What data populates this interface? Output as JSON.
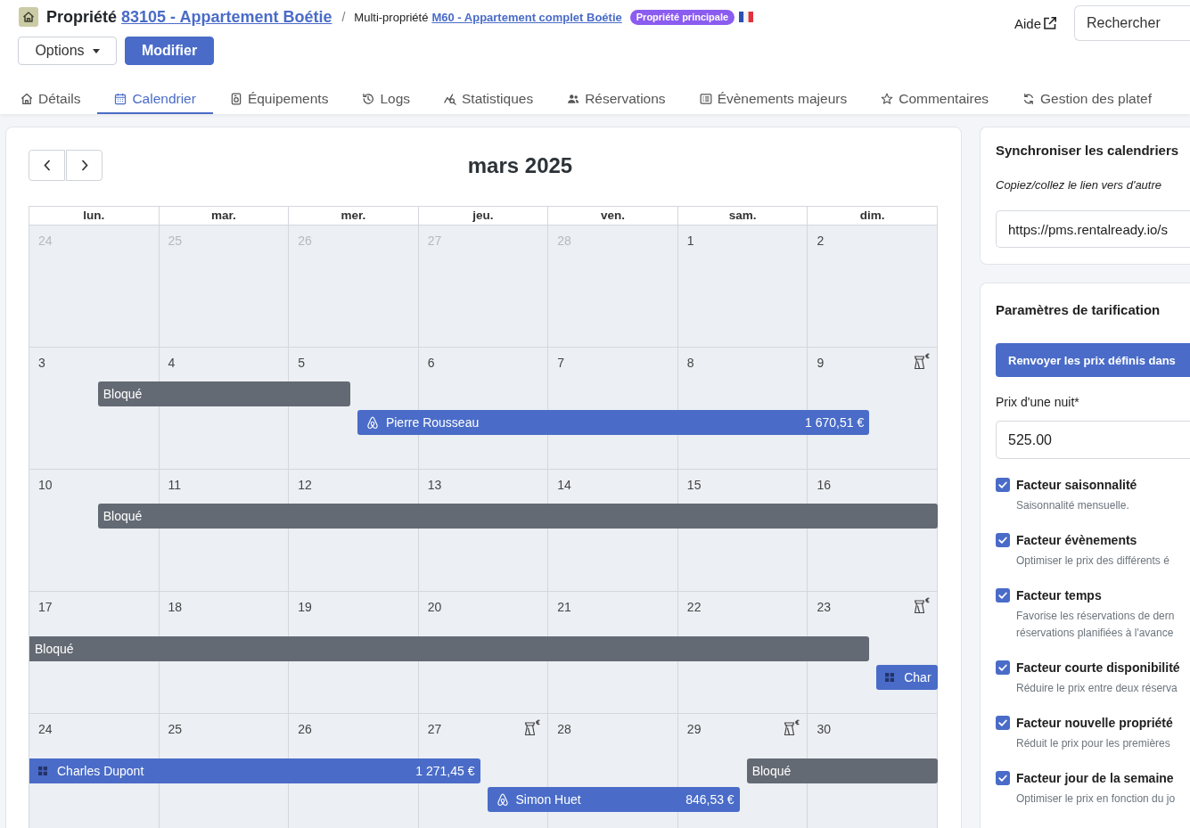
{
  "header": {
    "title": "Propriété",
    "property_link": "83105 - Appartement Boétie",
    "separator": "/",
    "parent_label": "Multi-propriété",
    "parent_link": "M60 - Appartement complet Boétie",
    "badge": "Propriété principale",
    "help": "Aide",
    "search": {
      "placeholder": "Rechercher"
    }
  },
  "actions": [
    {
      "kind": "dropdown",
      "label": "Options"
    },
    {
      "kind": "primary",
      "label": "Modifier"
    }
  ],
  "tabs": [
    {
      "label": "Détails",
      "selected": false
    },
    {
      "label": "Calendrier",
      "selected": true
    },
    {
      "label": "Équipements",
      "selected": false
    },
    {
      "label": "Logs",
      "selected": false
    },
    {
      "label": "Statistiques",
      "selected": false
    },
    {
      "label": "Réservations",
      "selected": false
    },
    {
      "label": "Évènements majeurs",
      "selected": false
    },
    {
      "label": "Commentaires",
      "selected": false
    },
    {
      "label": "Gestion des platef",
      "selected": false
    }
  ],
  "calendar": {
    "title": "mars 2025",
    "weekdays": [
      "lun.",
      "mar.",
      "mer.",
      "jeu.",
      "ven.",
      "sam.",
      "dim."
    ],
    "weeks": [
      {
        "days": [
          {
            "date": "24",
            "muted": true,
            "price_flag": false
          },
          {
            "date": "25",
            "muted": true,
            "price_flag": false
          },
          {
            "date": "26",
            "muted": true,
            "price_flag": false
          },
          {
            "date": "27",
            "muted": true,
            "price_flag": false
          },
          {
            "date": "28",
            "muted": true,
            "price_flag": false
          },
          {
            "date": "1",
            "muted": false,
            "price_flag": false
          },
          {
            "date": "2",
            "muted": false,
            "price_flag": false
          }
        ]
      },
      {
        "days": [
          {
            "date": "3",
            "muted": false,
            "price_flag": false,
            "bars": [
              {
                "kind": "blocked",
                "label": "Bloqué",
                "continued": false
              }
            ]
          },
          {
            "date": "4",
            "muted": false,
            "price_flag": false
          },
          {
            "date": "5",
            "muted": false,
            "price_flag": false,
            "ends": [
              {
                "kind": "blocked"
              }
            ],
            "bars": [
              {
                "kind": "airbnb",
                "label": "Pierre Rousseau",
                "amount": "1 670,51 €",
                "continued": false
              }
            ]
          },
          {
            "date": "6",
            "muted": false,
            "price_flag": false
          },
          {
            "date": "7",
            "muted": false,
            "price_flag": false
          },
          {
            "date": "8",
            "muted": false,
            "price_flag": false
          },
          {
            "date": "9",
            "muted": false,
            "price_flag": true,
            "ends": [
              {
                "kind": "airbnb"
              }
            ]
          }
        ]
      },
      {
        "days": [
          {
            "date": "10",
            "muted": false,
            "price_flag": false,
            "bars": [
              {
                "kind": "blocked",
                "label": "Bloqué",
                "continued": false
              }
            ]
          },
          {
            "date": "11",
            "muted": false,
            "price_flag": false
          },
          {
            "date": "12",
            "muted": false,
            "price_flag": false
          },
          {
            "date": "13",
            "muted": false,
            "price_flag": false
          },
          {
            "date": "14",
            "muted": false,
            "price_flag": false
          },
          {
            "date": "15",
            "muted": false,
            "price_flag": false
          },
          {
            "date": "16",
            "muted": false,
            "price_flag": false
          }
        ]
      },
      {
        "days": [
          {
            "date": "17",
            "muted": false,
            "price_flag": false,
            "bars": [
              {
                "kind": "blocked",
                "label": "Bloqué",
                "continued": true
              }
            ]
          },
          {
            "date": "18",
            "muted": false,
            "price_flag": false
          },
          {
            "date": "19",
            "muted": false,
            "price_flag": false
          },
          {
            "date": "20",
            "muted": false,
            "price_flag": false
          },
          {
            "date": "21",
            "muted": false,
            "price_flag": false
          },
          {
            "date": "22",
            "muted": false,
            "price_flag": false
          },
          {
            "date": "23",
            "muted": false,
            "price_flag": true,
            "ends": [
              {
                "kind": "blocked"
              }
            ],
            "bars": [
              {
                "kind": "booking",
                "label": "Char",
                "continued": false
              }
            ]
          }
        ]
      },
      {
        "days": [
          {
            "date": "24",
            "muted": false,
            "price_flag": false,
            "bars": [
              {
                "kind": "booking",
                "label": "Charles Dupont",
                "amount": "1 271,45 €",
                "continued": true
              }
            ]
          },
          {
            "date": "25",
            "muted": false,
            "price_flag": false
          },
          {
            "date": "26",
            "muted": false,
            "price_flag": false
          },
          {
            "date": "27",
            "muted": false,
            "price_flag": true,
            "ends": [
              {
                "kind": "booking"
              }
            ],
            "bars": [
              {
                "kind": "airbnb",
                "label": "Simon Huet",
                "amount": "846,53 €",
                "continued": false
              }
            ]
          },
          {
            "date": "28",
            "muted": false,
            "price_flag": false
          },
          {
            "date": "29",
            "muted": false,
            "price_flag": true,
            "ends": [
              {
                "kind": "airbnb"
              }
            ],
            "bars": [
              {
                "kind": "blocked",
                "label": "Bloqué",
                "continued": false
              }
            ]
          },
          {
            "date": "30",
            "muted": false,
            "price_flag": false
          }
        ]
      }
    ]
  },
  "sync": {
    "title": "Synchroniser les calendriers",
    "hint": "Copiez/collez le lien vers d'autre",
    "url": "https://pms.rentalready.io/s"
  },
  "pricing": {
    "title": "Paramètres de tarification",
    "reset_button": "Renvoyer les prix définis dans",
    "price_label": "Prix d'une nuit*",
    "price_value": "525.00",
    "factors": [
      {
        "label": "Facteur saisonnalité",
        "description": [
          "Saisonnalité mensuelle."
        ],
        "checked": true
      },
      {
        "label": "Facteur évènements",
        "description": [
          "Optimiser le prix des différents é"
        ],
        "checked": true
      },
      {
        "label": "Facteur temps",
        "description": [
          "Favorise les réservations de dern",
          "réservations planifiées à l'avance"
        ],
        "checked": true
      },
      {
        "label": "Facteur courte disponibilité",
        "description": [
          "Réduire le prix entre deux réserva"
        ],
        "checked": true
      },
      {
        "label": "Facteur nouvelle propriété",
        "description": [
          "Réduit le prix pour les premières"
        ],
        "checked": true
      },
      {
        "label": "Facteur jour de la semaine",
        "description": [
          "Optimiser le prix en fonction du jo"
        ],
        "checked": true
      }
    ]
  }
}
